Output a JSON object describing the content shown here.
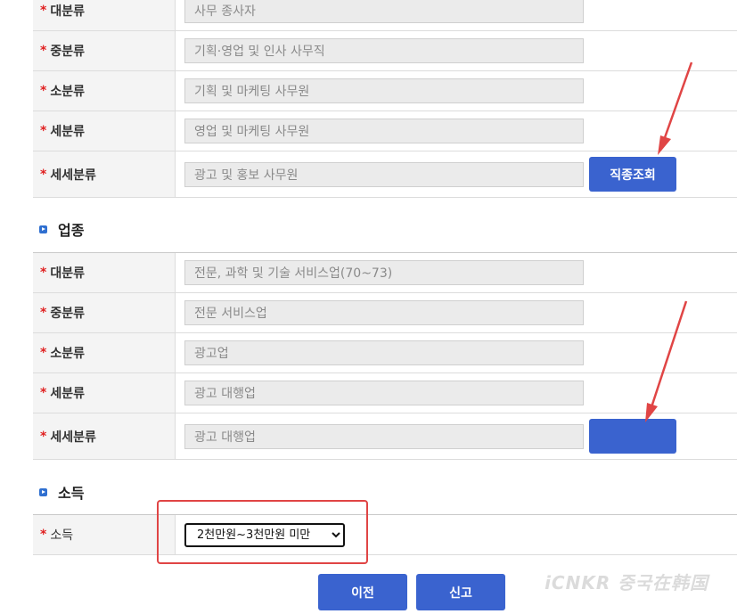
{
  "job_rows": [
    {
      "label": "대분류",
      "value": "사무 종사자"
    },
    {
      "label": "중분류",
      "value": "기획·영업 및 인사 사무직"
    },
    {
      "label": "소분류",
      "value": "기획 및 마케팅 사무원"
    },
    {
      "label": "세분류",
      "value": "영업 및 마케팅 사무원"
    },
    {
      "label": "세세분류",
      "value": "광고 및 홍보 사무원"
    }
  ],
  "job_lookup_label": "직종조회",
  "industry": {
    "section_title": "업종",
    "rows": [
      {
        "label": "대분류",
        "value": "전문, 과학 및 기술 서비스업(70~73)"
      },
      {
        "label": "중분류",
        "value": "전문 서비스업"
      },
      {
        "label": "소분류",
        "value": "광고업"
      },
      {
        "label": "세분류",
        "value": "광고 대행업"
      },
      {
        "label": "세세분류",
        "value": "광고 대행업"
      }
    ],
    "lookup_label": ""
  },
  "income": {
    "section_title": "소득",
    "label": "소득",
    "selected": "2천만원~3천만원 미만"
  },
  "buttons": {
    "prev": "이전",
    "report": "신고"
  },
  "required_mark": "*",
  "watermark": "iCNKR 중국在韩国",
  "colors": {
    "accent": "#3a63cf",
    "required": "#e02020",
    "annotation": "#e04545"
  }
}
